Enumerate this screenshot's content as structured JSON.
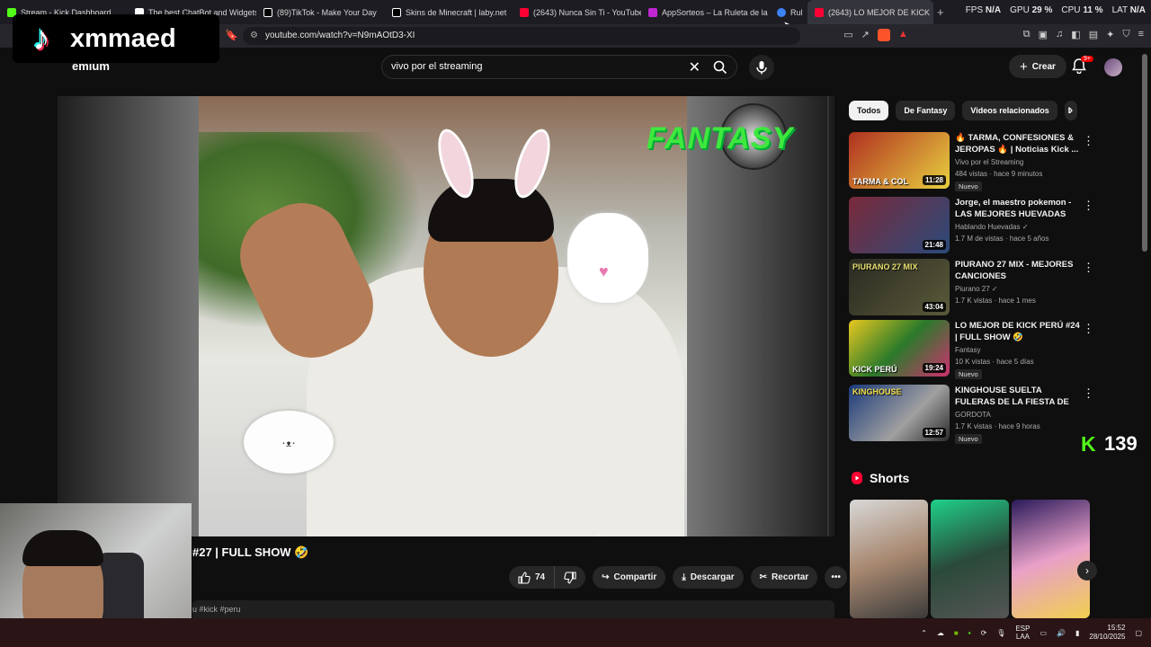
{
  "browser": {
    "tabs": [
      {
        "label": "Stream - Kick Dashboard",
        "color": "#53fc18"
      },
      {
        "label": "The best ChatBot and Widgets",
        "color": "#ffffff"
      },
      {
        "label": "(89)TikTok - Make Your Day",
        "color": "#ffffff"
      },
      {
        "label": "Skins de Minecraft | laby.net",
        "color": "#ffffff"
      },
      {
        "label": "(2643) Nunca Sin Ti - YouTube",
        "color": "#ff0033"
      },
      {
        "label": "AppSorteos – La Ruleta de la S",
        "color": "#c026d3"
      },
      {
        "label": "Rul",
        "color": "#3b82f6"
      },
      {
        "label": "(2643) LO MEJOR DE KICK",
        "color": "#ff0033"
      }
    ],
    "new_tab": "+",
    "url": "youtube.com/watch?v=N9mAOtD3-XI",
    "perf": {
      "fps_label": "FPS",
      "fps_value": "N/A",
      "gpu_label": "GPU",
      "gpu_value": "29 %",
      "cpu_label": "CPU",
      "cpu_value": "11 %",
      "lat_label": "LAT",
      "lat_value": "N/A"
    }
  },
  "youtube": {
    "premium_label": "emium",
    "search_value": "vivo por el streaming",
    "create_label": "Crear",
    "notif_badge": "9+"
  },
  "video": {
    "overlay_text": "FANTASY",
    "title": "#27 | FULL SHOW 🤣",
    "like_count": "74",
    "share_label": "Compartir",
    "download_label": "Descargar",
    "clip_label": "Recortar",
    "hashtags": "u #kick #peru"
  },
  "chips": [
    "Todos",
    "De Fantasy",
    "Videos relacionados",
    "I"
  ],
  "recommendations": [
    {
      "title": "🔥 TARMA, CONFESIONES & JEROPAS 🔥 | Noticias Kick ...",
      "channel": "Vivo por el Streaming",
      "meta": "484 vistas · hace 9 minutos",
      "badge": "Nuevo",
      "duration": "11:28",
      "thumb_text": "TARMA & COL",
      "thumb_color": "#b03020"
    },
    {
      "title": "Jorge, el maestro pokemon - LAS MEJORES HUEVADAS",
      "channel": "Hablando Huevadas ✓",
      "meta": "1.7 M de vistas · hace 5 años",
      "badge": "",
      "duration": "21:48",
      "thumb_text": "",
      "thumb_color": "#7a2a3a"
    },
    {
      "title": "PIURANO 27 MIX - MEJORES CANCIONES",
      "channel": "Piurano 27 ✓",
      "meta": "1.7 K vistas · hace 1 mes",
      "badge": "",
      "duration": "43:04",
      "thumb_text": "PIURANO 27 MIX",
      "thumb_color": "#3a3a2a"
    },
    {
      "title": "LO MEJOR DE KICK PERÚ #24 | FULL SHOW 🤣",
      "channel": "Fantasy",
      "meta": "10 K vistas · hace 5 días",
      "badge": "Nuevo",
      "duration": "19:24",
      "thumb_text": "KICK PERÚ",
      "thumb_color": "#2a7a2a"
    },
    {
      "title": "KINGHOUSE SUELTA FULERAS DE LA FIESTA DE JAMES😱 S...",
      "channel": "GORDOTA",
      "meta": "1.7 K vistas · hace 9 horas",
      "badge": "Nuevo",
      "duration": "12:57",
      "thumb_text": "KINGHOUSE",
      "thumb_color": "#1a3a7a"
    }
  ],
  "kick_viewers": "139",
  "shorts_label": "Shorts",
  "tiktok_handle": "xmmaed",
  "taskbar": {
    "lang_1": "ESP",
    "lang_2": "LAA",
    "time": "15:52",
    "date": "28/10/2025"
  }
}
